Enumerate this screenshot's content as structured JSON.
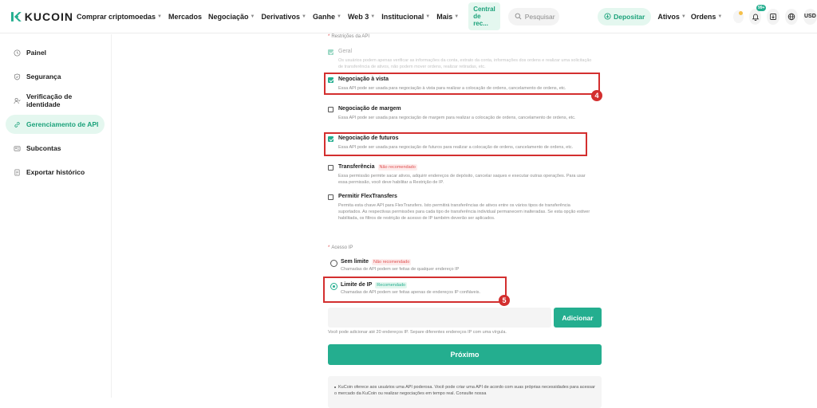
{
  "brand": {
    "name": "KUCOIN",
    "accent": "#24ae8f",
    "highlight": "#d32f2f"
  },
  "nav": {
    "items": [
      {
        "label": "Comprar criptomoedas",
        "caret": true
      },
      {
        "label": "Mercados",
        "caret": false
      },
      {
        "label": "Negociação",
        "caret": true
      },
      {
        "label": "Derivativos",
        "caret": true
      },
      {
        "label": "Ganhe",
        "caret": true
      },
      {
        "label": "Web 3",
        "caret": true
      },
      {
        "label": "Institucional",
        "caret": true
      },
      {
        "label": "Mais",
        "caret": true
      }
    ],
    "pill": "Central de rec...",
    "search_placeholder": "Pesquisar",
    "deposit": "Depositar",
    "assets": "Ativos",
    "orders": "Ordens",
    "notification_badge": "99+",
    "currency": "USD"
  },
  "sidebar": {
    "items": [
      {
        "label": "Painel",
        "icon": "clock-icon"
      },
      {
        "label": "Segurança",
        "icon": "shield-icon"
      },
      {
        "label": "Verificação de identidade",
        "icon": "user-check-icon"
      },
      {
        "label": "Gerenciamento de API",
        "icon": "link-icon",
        "active": true
      },
      {
        "label": "Subcontas",
        "icon": "subaccounts-icon"
      },
      {
        "label": "Exportar histórico",
        "icon": "export-icon"
      }
    ]
  },
  "form": {
    "restrictions_label": "Restrições da API",
    "permissions": [
      {
        "title": "Geral",
        "desc": "Os usuários podem apenas verificar as informações da conta, extrato da conta, informações dos ordens e realizar uma solicitação de transferência de ativos, não podem mover ordens, realizar retiradas, etc.",
        "checked": true,
        "disabled": true
      },
      {
        "title": "Negociação à vista",
        "desc": "Essa API pode ser usada para negociação à vista para realizar a colocação de ordens, cancelamento de ordens, etc.",
        "checked": true
      },
      {
        "title": "Negociação de margem",
        "desc": "Essa API pode ser usada para negociação de margem para realizar a colocação de ordens, cancelamento de ordens, etc.",
        "checked": false
      },
      {
        "title": "Negociação de futuros",
        "desc": "Essa API pode ser usada para negociação de futuros para realizar a colocação de ordens, cancelamento de ordens, etc.",
        "checked": true
      },
      {
        "title": "Transferência",
        "tag": "Não recomendado",
        "desc": "Essa permissão permite sacar ativos, adquirir endereços de depósito, cancelar saques e executar outras operações. Para usar essa permissão, você deve habilitar a Restrição de IP.",
        "checked": false
      },
      {
        "title": "Permitir FlexTransfers",
        "desc": "Permita esta chave API para FlexTransfers. Isto permitirá transferências de ativos entre os vários tipos de transferência suportados. As respectivas permissões para cada tipo de transferência individual permanecem inalteradas. Se esta opção estiver habilitada, os filtros de restrição de acesso de IP também deverão ser aplicados.",
        "checked": false
      }
    ],
    "ip_access_label": "Acesso IP",
    "ip_options": [
      {
        "title": "Sem limite",
        "tag": "Não recomendado",
        "desc": "Chamadas de API podem ser feitas de qualquer endereço IP",
        "selected": false
      },
      {
        "title": "Limite de IP",
        "tag": "Recomendado",
        "desc": "Chamadas de API podem ser feitas apenas de endereços IP confiáveis.",
        "selected": true
      }
    ],
    "add_button": "Adicionar",
    "ip_hint": "Você pode adicionar até 20 endereços IP. Separe diferentes endereços IP com uma vírgula.",
    "next_button": "Próximo",
    "note": "KuCoin oferece aos usuários uma API poderosa. Você pode criar uma API de acordo com suas próprias necessidades para acessar o mercado da KuCoin ou realizar negociações em tempo real. Consulte nossa"
  },
  "annotations": {
    "step_a": "4",
    "step_b": "5"
  }
}
